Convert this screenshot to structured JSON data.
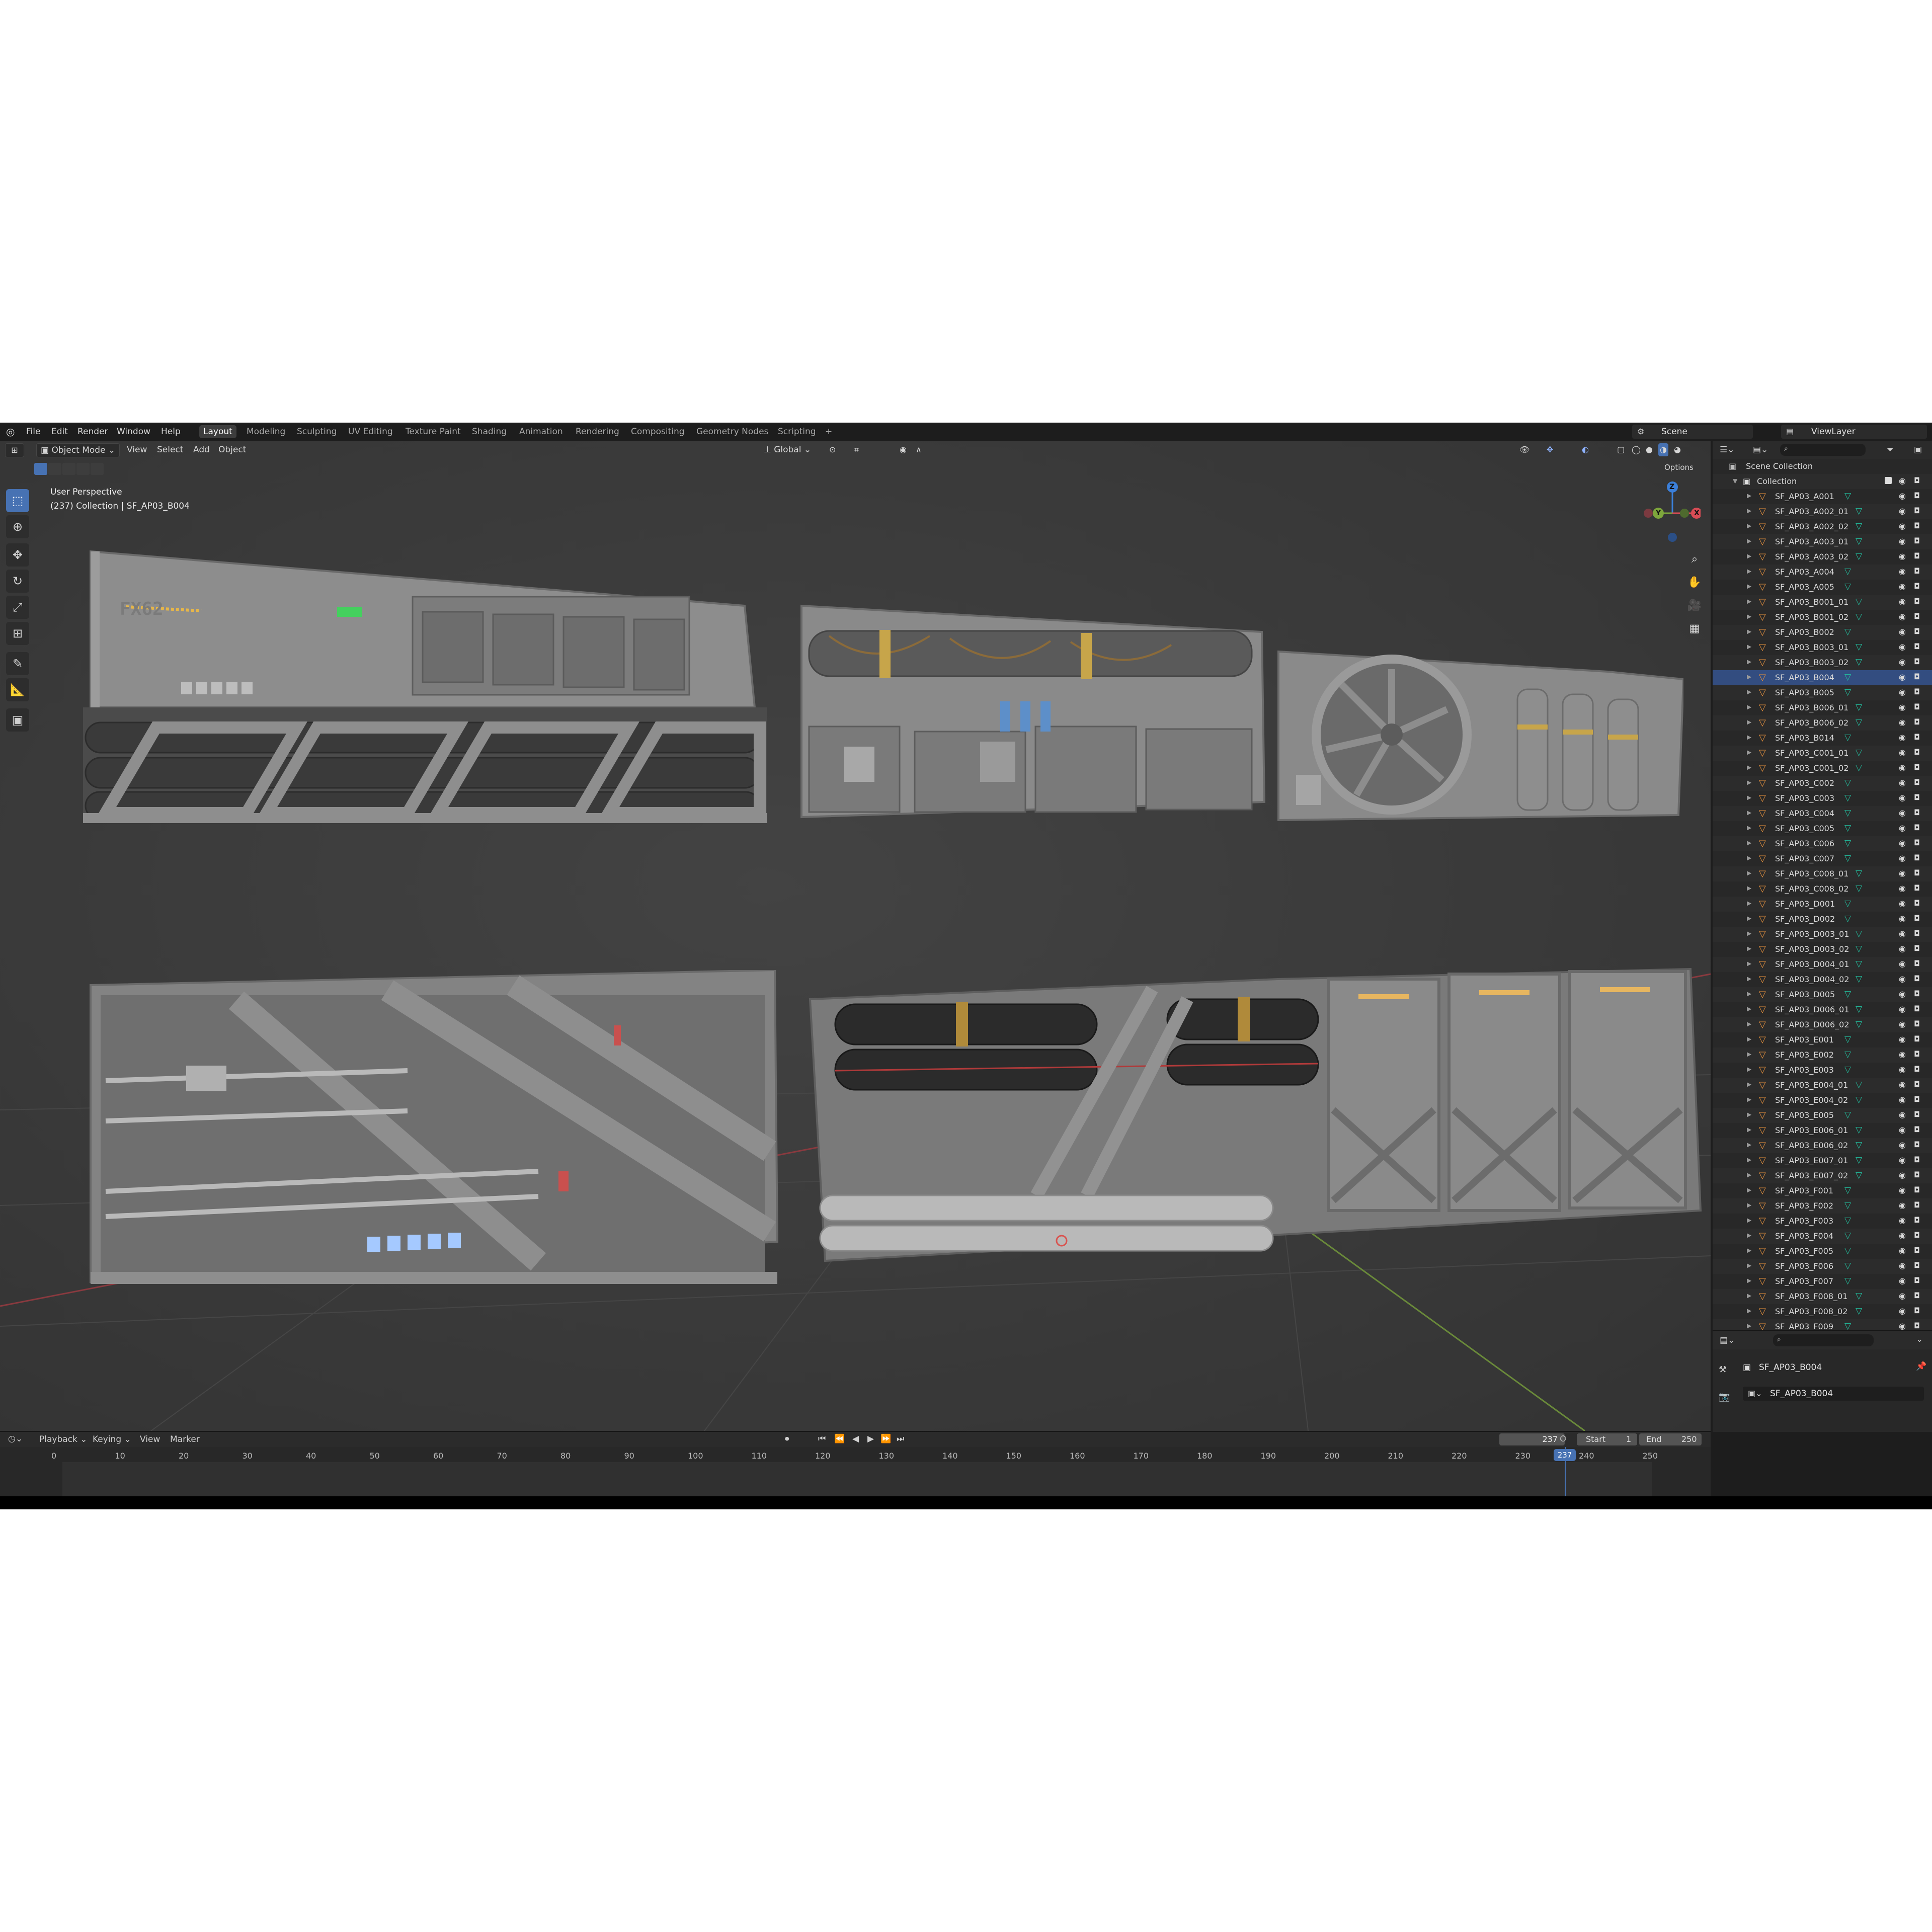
{
  "menus": [
    "File",
    "Edit",
    "Render",
    "Window",
    "Help"
  ],
  "workspaces": [
    "Layout",
    "Modeling",
    "Sculpting",
    "UV Editing",
    "Texture Paint",
    "Shading",
    "Animation",
    "Rendering",
    "Compositing",
    "Geometry Nodes",
    "Scripting",
    "+"
  ],
  "scene": {
    "label": "Scene",
    "viewlayer": "ViewLayer"
  },
  "viewport_header": {
    "mode": "Object Mode",
    "view": "View",
    "select": "Select",
    "add": "Add",
    "object": "Object",
    "orientation": "Global",
    "options": "Options"
  },
  "viewport_info": {
    "perspective": "User Perspective",
    "context": "(237) Collection | SF_AP03_B004"
  },
  "gizmo": {
    "z": "Z",
    "y": "Y",
    "x": "X"
  },
  "model_label": "FX62",
  "outliner": {
    "scene_collection": "Scene Collection",
    "collection": "Collection",
    "selected": "SF_AP03_B004",
    "items": [
      "SF_AP03_A001",
      "SF_AP03_A002_01",
      "SF_AP03_A002_02",
      "SF_AP03_A003_01",
      "SF_AP03_A003_02",
      "SF_AP03_A004",
      "SF_AP03_A005",
      "SF_AP03_B001_01",
      "SF_AP03_B001_02",
      "SF_AP03_B002",
      "SF_AP03_B003_01",
      "SF_AP03_B003_02",
      "SF_AP03_B004",
      "SF_AP03_B005",
      "SF_AP03_B006_01",
      "SF_AP03_B006_02",
      "SF_AP03_B014",
      "SF_AP03_C001_01",
      "SF_AP03_C001_02",
      "SF_AP03_C002",
      "SF_AP03_C003",
      "SF_AP03_C004",
      "SF_AP03_C005",
      "SF_AP03_C006",
      "SF_AP03_C007",
      "SF_AP03_C008_01",
      "SF_AP03_C008_02",
      "SF_AP03_D001",
      "SF_AP03_D002",
      "SF_AP03_D003_01",
      "SF_AP03_D003_02",
      "SF_AP03_D004_01",
      "SF_AP03_D004_02",
      "SF_AP03_D005",
      "SF_AP03_D006_01",
      "SF_AP03_D006_02",
      "SF_AP03_E001",
      "SF_AP03_E002",
      "SF_AP03_E003",
      "SF_AP03_E004_01",
      "SF_AP03_E004_02",
      "SF_AP03_E005",
      "SF_AP03_E006_01",
      "SF_AP03_E006_02",
      "SF_AP03_E007_01",
      "SF_AP03_E007_02",
      "SF_AP03_F001",
      "SF_AP03_F002",
      "SF_AP03_F003",
      "SF_AP03_F004",
      "SF_AP03_F005",
      "SF_AP03_F006",
      "SF_AP03_F007",
      "SF_AP03_F008_01",
      "SF_AP03_F008_02",
      "SF_AP03_F009"
    ]
  },
  "properties": {
    "object_name": "SF_AP03_B004",
    "data_name": "SF_AP03_B004"
  },
  "timeline": {
    "menus": [
      "Playback",
      "Keying",
      "View",
      "Marker"
    ],
    "current_frame": "237",
    "start_label": "Start",
    "start": "1",
    "end_label": "End",
    "end": "250",
    "ticks": [
      "0",
      "10",
      "20",
      "30",
      "40",
      "50",
      "60",
      "70",
      "80",
      "90",
      "100",
      "110",
      "120",
      "130",
      "140",
      "150",
      "160",
      "170",
      "180",
      "190",
      "200",
      "210",
      "220",
      "230",
      "240",
      "250"
    ]
  },
  "colors": {
    "accent": "#4772b3",
    "object_orange": "#e5903c",
    "mesh_teal": "#22c0a0",
    "axis_x": "#d94c55",
    "axis_y": "#7ea63c",
    "axis_z": "#3b7fd9"
  }
}
